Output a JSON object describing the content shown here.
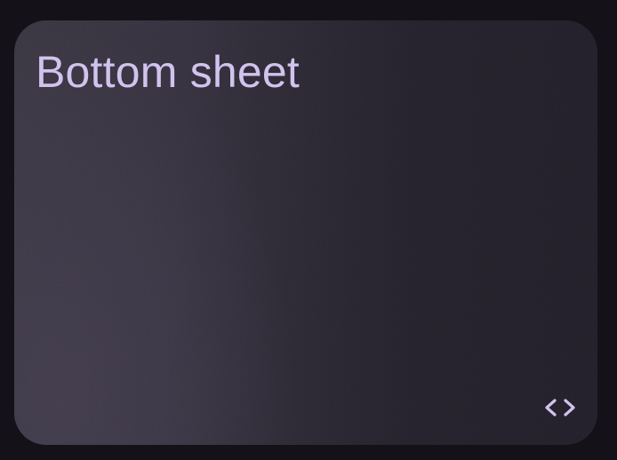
{
  "card": {
    "title": "Bottom sheet",
    "code_button_icon": "code-brackets-icon"
  },
  "colors": {
    "page_background": "#141218",
    "card_background": "#221f29",
    "card_highlight": "#38343f",
    "title_text": "#d1c3ee",
    "icon": "#d1c3ee"
  }
}
